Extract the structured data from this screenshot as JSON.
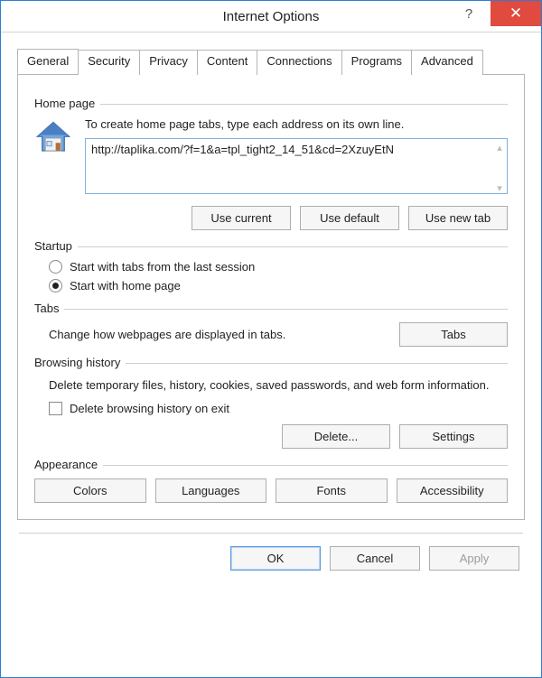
{
  "window": {
    "title": "Internet Options"
  },
  "tabs": {
    "items": [
      "General",
      "Security",
      "Privacy",
      "Content",
      "Connections",
      "Programs",
      "Advanced"
    ],
    "active": 0
  },
  "homepage": {
    "group": "Home page",
    "desc": "To create home page tabs, type each address on its own line.",
    "value": "http://taplika.com/?f=1&a=tpl_tight2_14_51&cd=2XzuyEtN",
    "use_current": "Use current",
    "use_default": "Use default",
    "use_new_tab": "Use new tab"
  },
  "startup": {
    "group": "Startup",
    "opt_last": "Start with tabs from the last session",
    "opt_home": "Start with home page",
    "selected": "home"
  },
  "tabsection": {
    "group": "Tabs",
    "desc": "Change how webpages are displayed in tabs.",
    "button": "Tabs"
  },
  "history": {
    "group": "Browsing history",
    "desc": "Delete temporary files, history, cookies, saved passwords, and web form information.",
    "checkbox": "Delete browsing history on exit",
    "delete": "Delete...",
    "settings": "Settings"
  },
  "appearance": {
    "group": "Appearance",
    "colors": "Colors",
    "languages": "Languages",
    "fonts": "Fonts",
    "accessibility": "Accessibility"
  },
  "footer": {
    "ok": "OK",
    "cancel": "Cancel",
    "apply": "Apply"
  }
}
